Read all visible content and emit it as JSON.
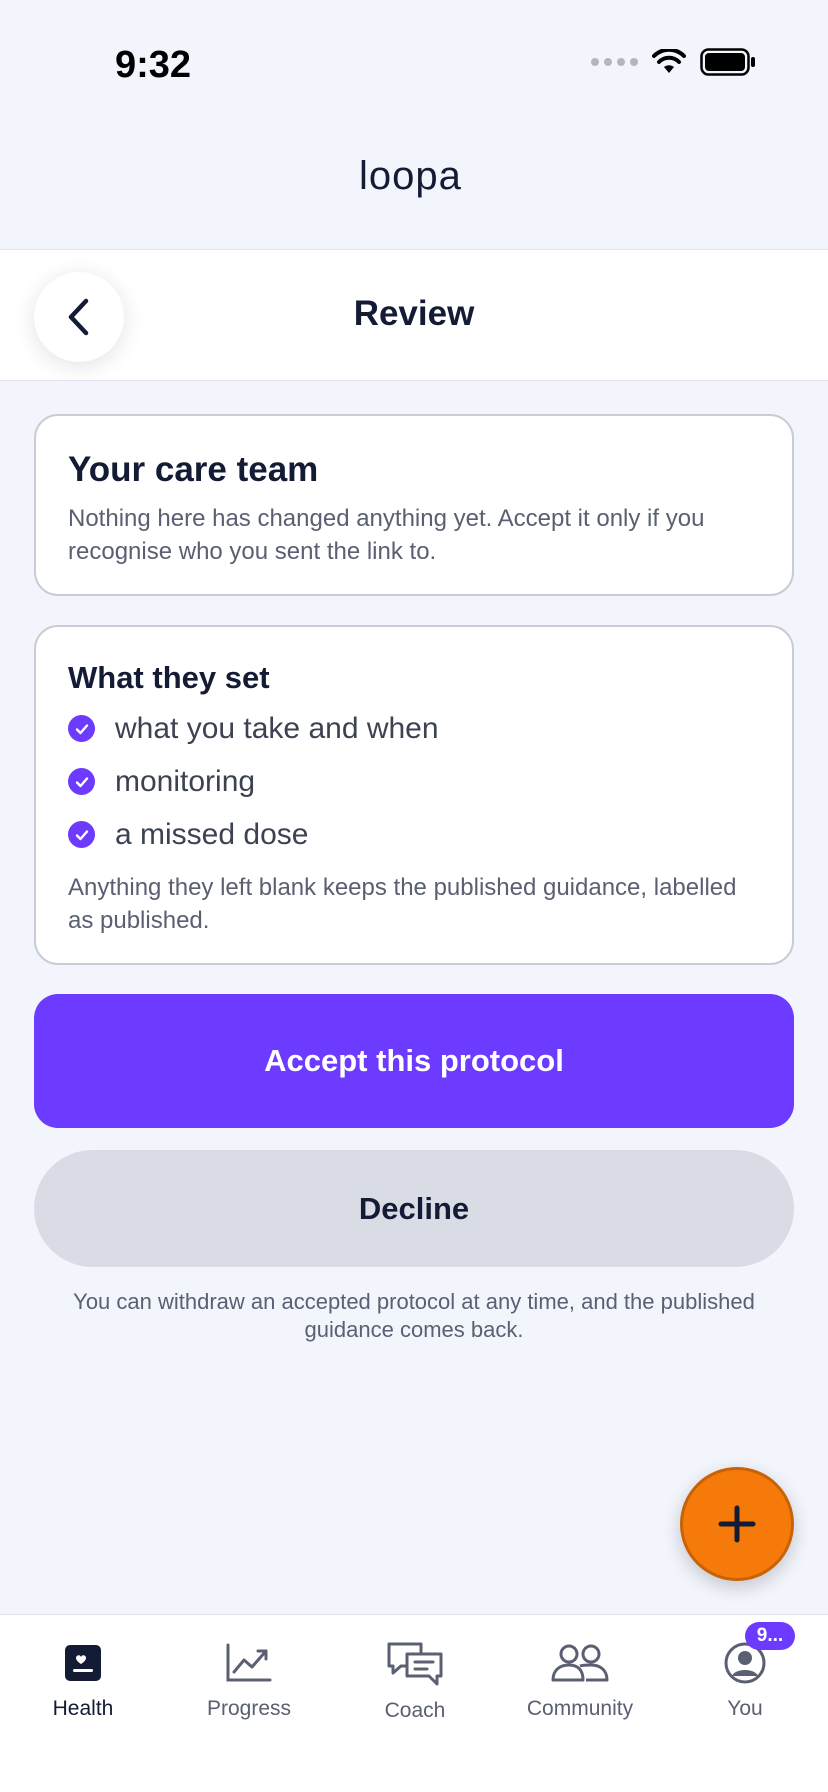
{
  "status_bar": {
    "time": "9:32"
  },
  "brand": {
    "logo_text": "loopa"
  },
  "header": {
    "title": "Review"
  },
  "care_team_card": {
    "title": "Your care team",
    "body": "Nothing here has changed anything yet. Accept it only if you recognise who you sent the link to."
  },
  "settings_card": {
    "title": "What they set",
    "items": [
      "what you take and when",
      "monitoring",
      "a missed dose"
    ],
    "note": "Anything they left blank keeps the published guidance, labelled as published."
  },
  "actions": {
    "accept_label": "Accept this protocol",
    "decline_label": "Decline"
  },
  "footnote": "You can withdraw an accepted protocol at any time, and the published guidance comes back.",
  "tabs": [
    {
      "label": "Health",
      "icon": "health-icon",
      "active": true
    },
    {
      "label": "Progress",
      "icon": "progress-chart-icon"
    },
    {
      "label": "Coach",
      "icon": "chat-bubbles-icon"
    },
    {
      "label": "Community",
      "icon": "people-icon"
    },
    {
      "label": "You",
      "icon": "user-avatar-icon",
      "badge": "9..."
    }
  ],
  "colors": {
    "accent": "#6c3bff",
    "fab": "#f57a0a",
    "background": "#f3f5fd",
    "text_primary": "#141b34"
  }
}
